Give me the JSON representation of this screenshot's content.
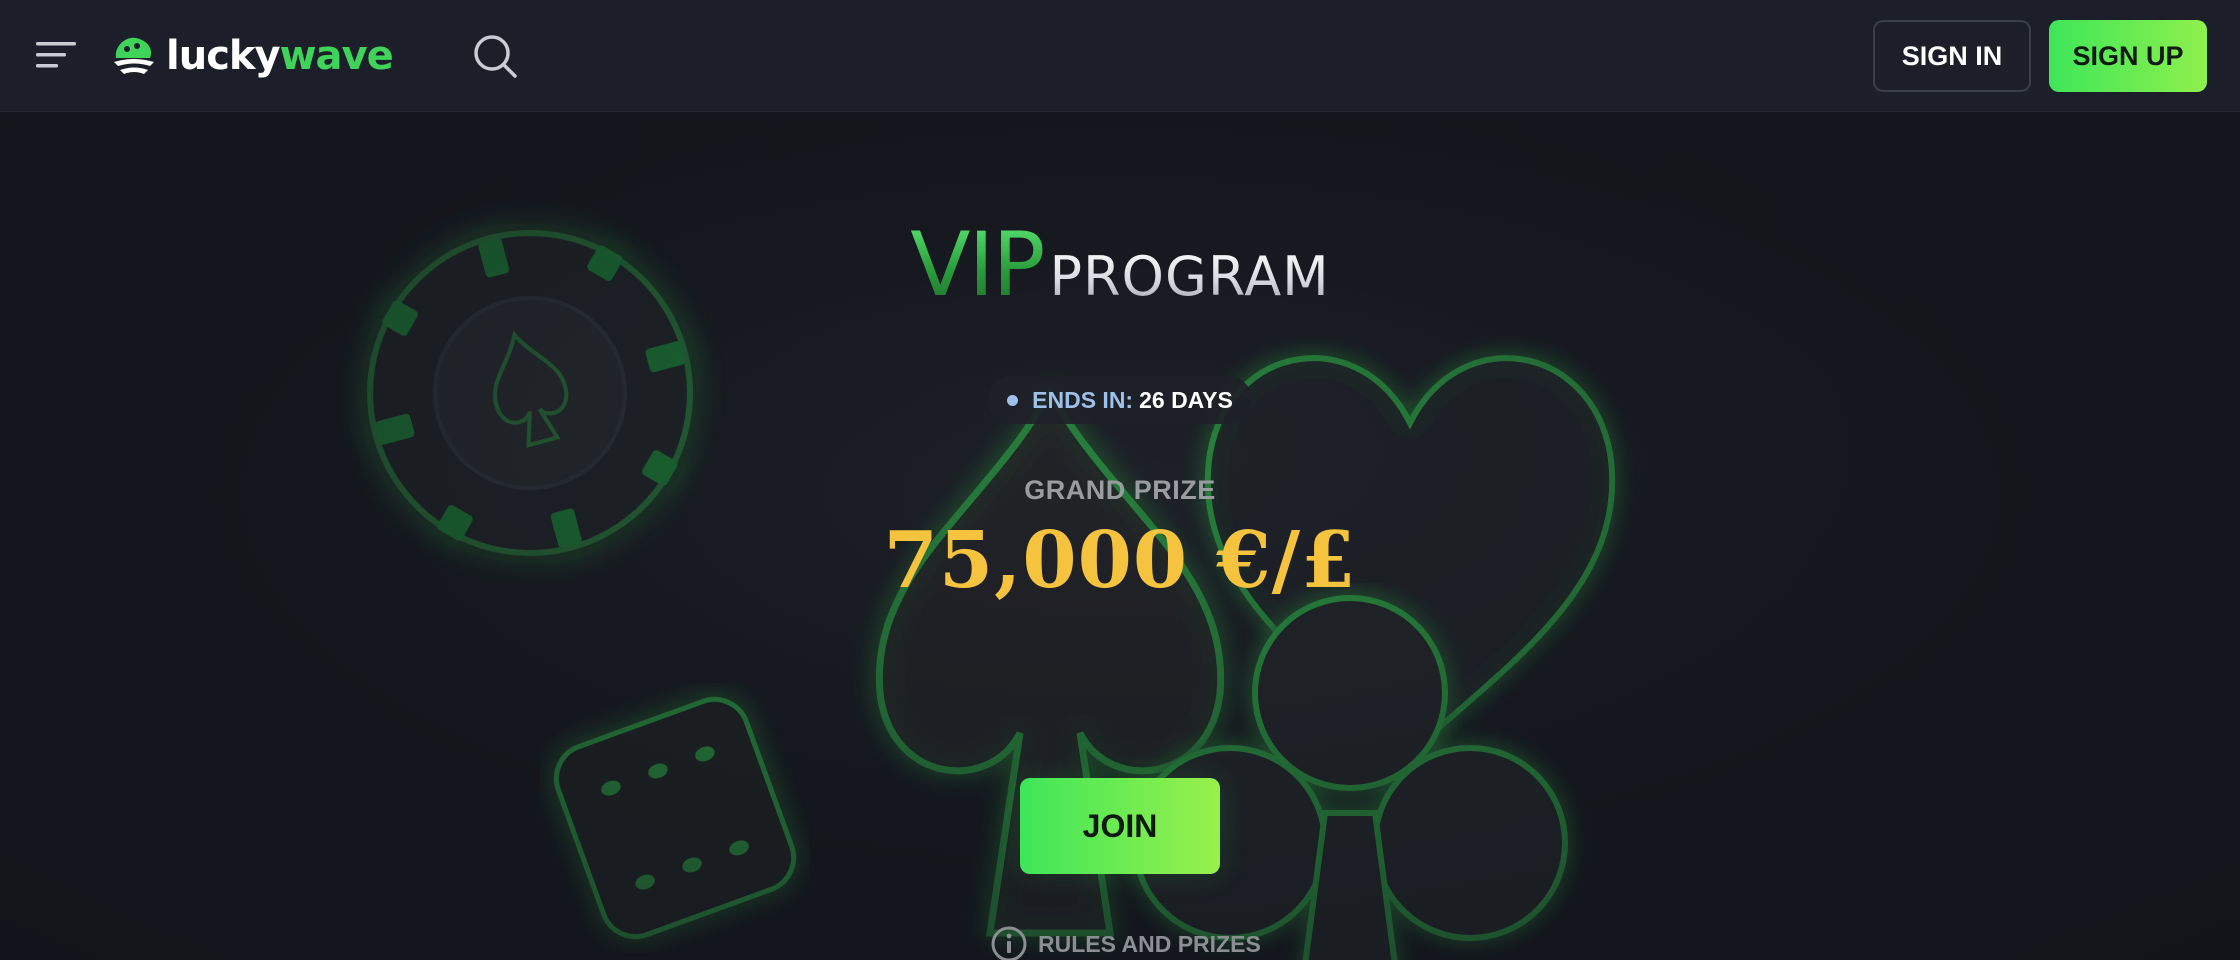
{
  "header": {
    "menu_icon": "hamburger-menu-icon",
    "logo": {
      "part1": "lucky",
      "part2": "wave"
    },
    "search_icon": "search-icon",
    "signin_label": "SIGN IN",
    "signup_label": "SIGN UP"
  },
  "hero": {
    "title_vip": "VIP",
    "title_program": "PROGRAM",
    "ends_label": "ENDS IN:",
    "ends_value": "26 DAYS",
    "grand_prize_label": "GRAND PRIZE",
    "grand_prize_amount": "75,000 €/£",
    "join_label": "JOIN",
    "rules_label": "RULES AND PRIZES",
    "rules_icon": "info-icon",
    "decorations": [
      "poker-chip",
      "dice",
      "spade-card-suit",
      "heart-card-suit",
      "club-card-suit"
    ]
  },
  "colors": {
    "accent_green": "#3ee65a",
    "accent_lime": "#8ff04c",
    "prize_gold": "#f5c33d",
    "header_bg": "#1c1f29",
    "page_bg": "#12151b"
  }
}
